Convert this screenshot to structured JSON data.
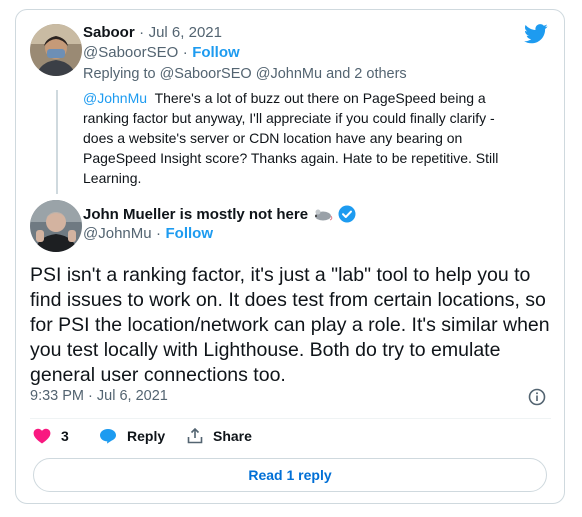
{
  "reply_tweet": {
    "author_name": "Saboor",
    "sep": "·",
    "date": "Jul 6, 2021",
    "handle": "@SaboorSEO",
    "follow_label": "Follow",
    "replying_prefix": "Replying to",
    "replying_handle": "@SaboorSEO",
    "replying_handle2": "@JohnMu",
    "replying_suffix": "and 2 others",
    "mention": "@JohnMu",
    "text_line1": "There's a lot of buzz out there on PageSpeed being a",
    "text_rest": "ranking factor but anyway, I'll appreciate if you could finally clarify - does a website's server or CDN location have any bearing on PageSpeed Insight score? Thanks again. Hate to be repetitive. Still Learning."
  },
  "main_tweet": {
    "author_name": "John Mueller is mostly not here",
    "handle": "@JohnMu",
    "follow_label": "Follow",
    "text": "PSI isn't a ranking factor, it's just a \"lab\" tool to help you to find issues to work on. It does test from certain locations, so for PSI the location/network can play a role. It's similar when you test locally with Lighthouse. Both do try to emulate general user connections too.",
    "timestamp": "9:33 PM · Jul 6, 2021"
  },
  "actions": {
    "like_count": "3",
    "reply_label": "Reply",
    "share_label": "Share"
  },
  "read_replies_label": "Read 1 reply",
  "colors": {
    "accent": "#1d9bf0",
    "like": "#f91880",
    "border": "#cfd9de",
    "muted": "#536471"
  }
}
